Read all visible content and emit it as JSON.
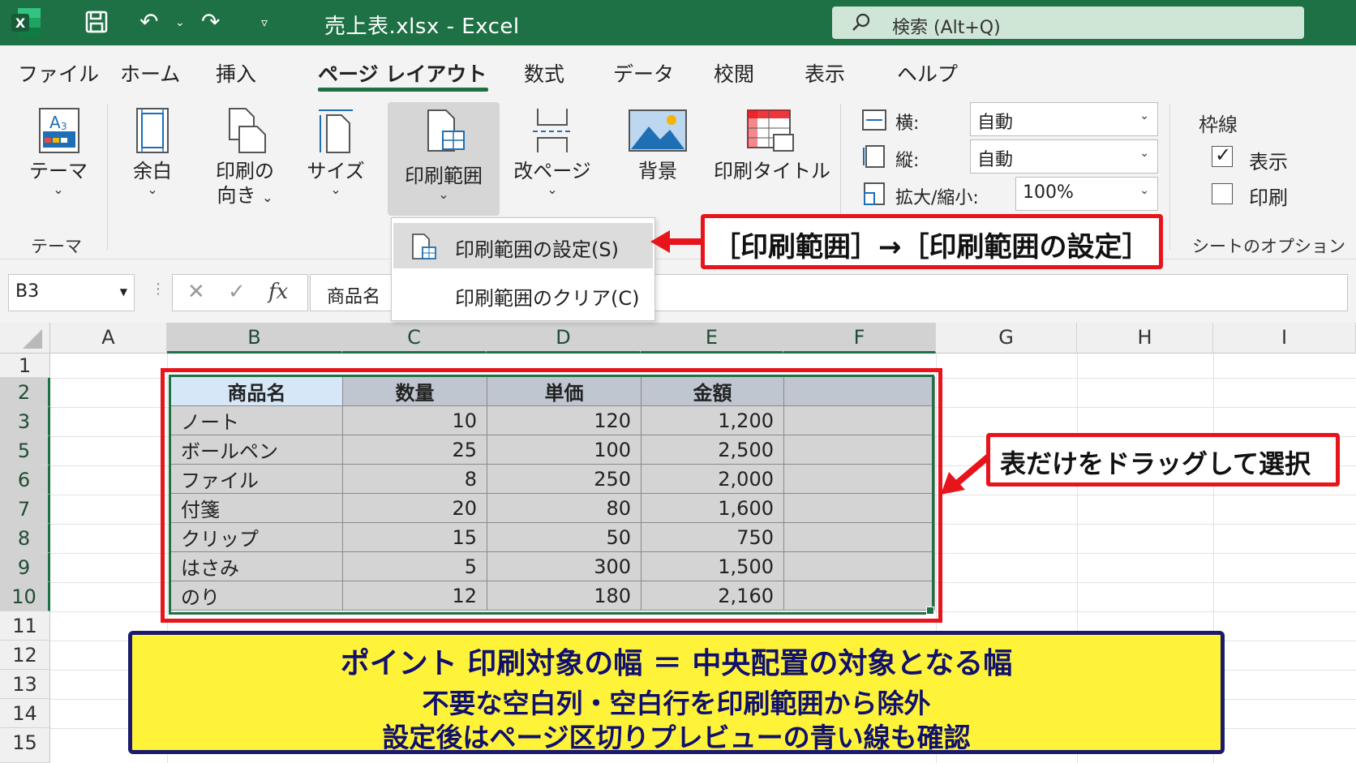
{
  "titlebar": {
    "title": "売上表.xlsx  -  Excel",
    "search_placeholder": "検索 (Alt+Q)",
    "customize_glyph": "▿"
  },
  "tabs": [
    {
      "label": "ファイル",
      "active": false
    },
    {
      "label": "ホーム",
      "active": false
    },
    {
      "label": "挿入",
      "active": false
    },
    {
      "label": "ページ レイアウト",
      "active": true
    },
    {
      "label": "数式",
      "active": false
    },
    {
      "label": "データ",
      "active": false
    },
    {
      "label": "校閲",
      "active": false
    },
    {
      "label": "表示",
      "active": false
    },
    {
      "label": "ヘルプ",
      "active": false
    }
  ],
  "ribbon": {
    "theme": {
      "label": "テーマ",
      "group_label": "テーマ"
    },
    "margins": {
      "label": "余白"
    },
    "orientation": {
      "label1": "印刷の",
      "label2": "向き"
    },
    "size": {
      "label": "サイズ"
    },
    "print_area": {
      "label": "印刷範囲"
    },
    "breaks": {
      "label": "改ページ"
    },
    "background": {
      "label": "背景"
    },
    "print_titles": {
      "label": "印刷タイトル"
    },
    "scale": {
      "width_label": "横:",
      "width_value": "自動",
      "height_label": "縦:",
      "height_value": "自動",
      "scale_label": "拡大/縮小:",
      "scale_value": "100%"
    },
    "sheet_options": {
      "gridlines_label": "枠線",
      "view_label": "表示",
      "view_checked": true,
      "print_label": "印刷",
      "print_checked": false,
      "group_label": "シートのオプション"
    }
  },
  "menu": {
    "set": "印刷範囲の設定(S)",
    "clear": "印刷範囲のクリア(C)"
  },
  "formula_bar": {
    "name_box": "B3",
    "cancel": "✕",
    "enter": "✓",
    "fx": "fx",
    "content": "商品名"
  },
  "grid": {
    "columns": [
      "A",
      "B",
      "C",
      "D",
      "E",
      "F",
      "G",
      "H",
      "I"
    ],
    "rows": [
      "1",
      "2",
      "3",
      "5",
      "6",
      "7",
      "8",
      "9",
      "10",
      "11",
      "12",
      "13",
      "14",
      "15"
    ]
  },
  "table": {
    "headers": [
      "商品名",
      "数量",
      "単価",
      "金額",
      ""
    ],
    "rows": [
      [
        "ノート",
        "10",
        "120",
        "1,200",
        ""
      ],
      [
        "ボールペン",
        "25",
        "100",
        "2,500",
        ""
      ],
      [
        "ファイル",
        "8",
        "250",
        "2,000",
        ""
      ],
      [
        "付箋",
        "20",
        "80",
        "1,600",
        ""
      ],
      [
        "クリップ",
        "15",
        "50",
        "750",
        ""
      ],
      [
        "はさみ",
        "5",
        "300",
        "1,500",
        ""
      ],
      [
        "のり",
        "12",
        "180",
        "2,160",
        ""
      ]
    ]
  },
  "annotations": {
    "callout_menu": "［印刷範囲］→［印刷範囲の設定］",
    "callout_drag": "表だけをドラッグして選択",
    "point_line1": "ポイント  印刷対象の幅 ＝ 中央配置の対象となる幅",
    "point_line2": "不要な空白列・空白行を印刷範囲から除外",
    "point_line3": "設定後はページ区切りプレビューの青い線も確認",
    "colors": {
      "red": "#e8141b",
      "yellow": "#fff33a",
      "navy": "#1b1b6e",
      "excel_green": "#1e7145"
    }
  }
}
